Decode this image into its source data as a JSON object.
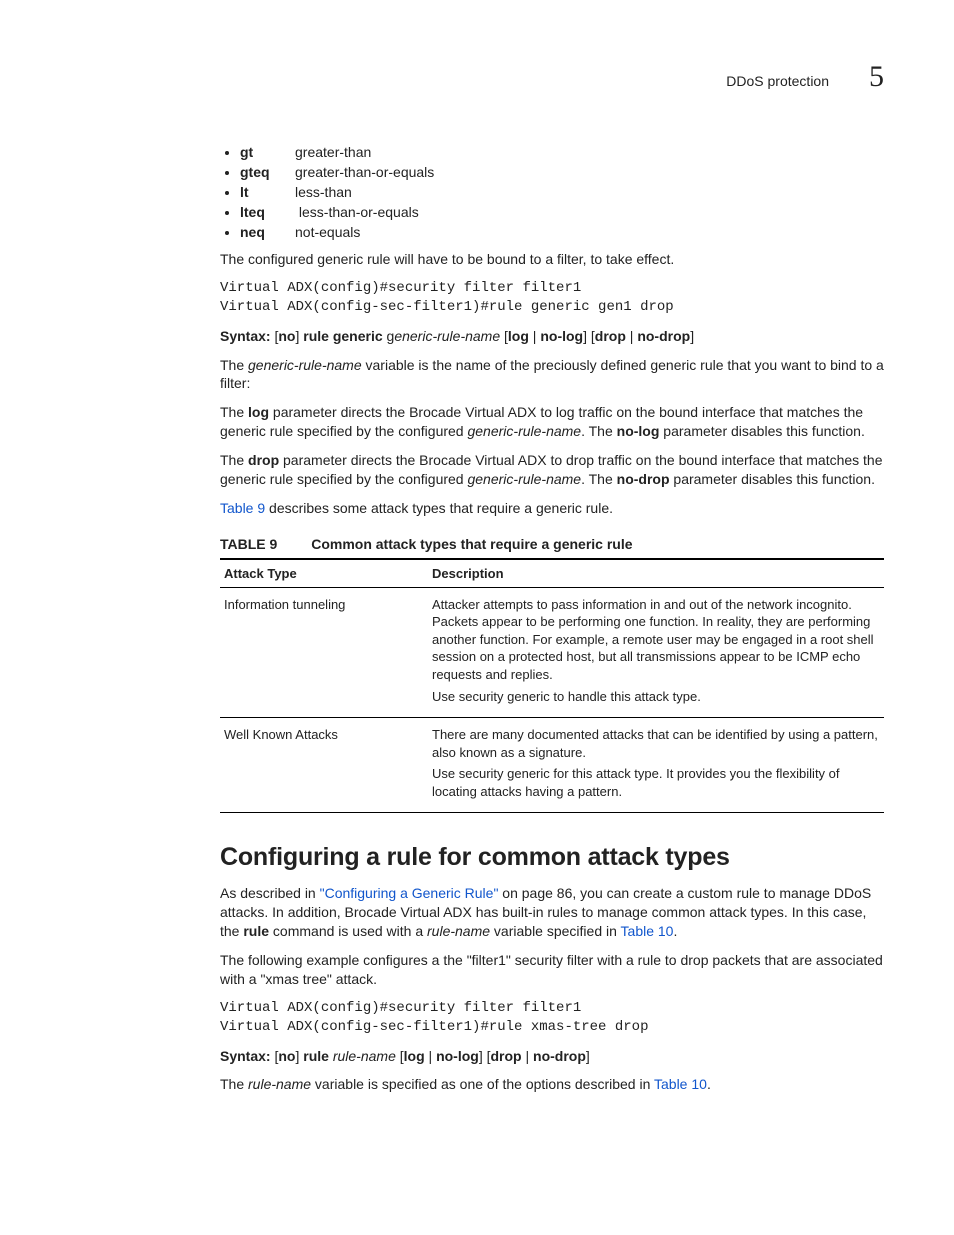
{
  "runhead": {
    "title": "DDoS protection",
    "chapter": "5"
  },
  "oplist": [
    {
      "term": "gt",
      "desc": "greater-than"
    },
    {
      "term": "gteq",
      "desc": "greater-than-or-equals"
    },
    {
      "term": "lt",
      "desc": "less-than"
    },
    {
      "term": "lteq",
      "desc": " less-than-or-equals"
    },
    {
      "term": "neq",
      "desc": "not-equals"
    }
  ],
  "p_bound_intro": "The configured generic rule will have to be bound to a filter, to take effect.",
  "code1": "Virtual ADX(config)#security filter filter1\nVirtual ADX(config-sec-filter1)#rule generic gen1 drop",
  "syntax1": {
    "label": "Syntax:  ",
    "pre_no": "[",
    "no": "no",
    "post_no": "] ",
    "rule_generic": "rule generic",
    "space_g": " g",
    "varname": "eneric-rule-name",
    "space": " ",
    "opt1a": "[",
    "log": "log",
    "pipe1": " | ",
    "nolog": "no-log",
    "opt1b": "] ",
    "opt2a": "[",
    "drop": "drop",
    "pipe2": " | ",
    "nodrop": "no-drop",
    "opt2b": "]"
  },
  "p_varname": {
    "pre": "The ",
    "var": "generic-rule-name",
    "post": " variable is the name of the preciously defined generic rule that you want to bind to a filter:"
  },
  "p_log": {
    "pre": "The ",
    "b1": "log",
    "mid1": " parameter directs the Brocade Virtual ADX to log traffic on the bound interface that matches the generic rule specified by the configured ",
    "var": "generic-rule-name",
    "mid2": ". The ",
    "b2": "no-log",
    "post": " parameter disables this function."
  },
  "p_drop": {
    "pre": "The ",
    "b1": "drop",
    "mid1": " parameter directs the Brocade Virtual ADX to drop traffic on the bound interface that matches the generic rule specified by the configured ",
    "var": "generic-rule-name",
    "mid2": ". The ",
    "b2": "no-drop",
    "post": " parameter disables this function."
  },
  "p_tableref": {
    "link": "Table 9",
    "post": " describes some attack types that require a generic rule."
  },
  "table9": {
    "label": "TABLE 9",
    "title": "Common attack types that require a generic rule",
    "head": {
      "c1": "Attack Type",
      "c2": "Description"
    },
    "rows": [
      {
        "c1": "Information tunneling",
        "c2a": "Attacker attempts to pass information in and out of the network incognito. Packets appear to be performing one function. In reality, they are performing another function. For example, a remote user may be engaged in a root shell session on a protected host, but all transmissions appear to be ICMP echo requests and replies.",
        "c2b": "Use security generic to handle this attack type."
      },
      {
        "c1": "Well Known Attacks",
        "c2a": "There are many documented attacks that can be identified by using a pattern, also known as a signature.",
        "c2b": "Use security generic for this attack type. It provides you the flexibility of locating attacks having a pattern."
      }
    ]
  },
  "h2": "Configuring a rule for common attack types",
  "p_common1": {
    "pre": "As described in ",
    "link1": "\"Configuring a Generic Rule\"",
    "mid1": " on page 86, you can create a custom rule to manage DDoS attacks. In addition, Brocade Virtual ADX has built-in rules to manage common attack types. In this case, the ",
    "b1": "rule",
    "mid2": " command is used with a ",
    "var": "rule-name",
    "mid3": " variable specified in ",
    "link2": "Table 10",
    "post": "."
  },
  "p_common2": "The following example configures a the \"filter1\" security filter with a rule to drop packets that are associated with a \"xmas tree\" attack.",
  "code2": "Virtual ADX(config)#security filter filter1\nVirtual ADX(config-sec-filter1)#rule xmas-tree drop",
  "syntax2": {
    "label": "Syntax:  ",
    "pre_no": "[",
    "no": "no",
    "post_no": "] ",
    "rule": "rule",
    "space": " ",
    "varname": "rule-name",
    "space2": " ",
    "opt1a": "[",
    "log": "log",
    "pipe1": " | ",
    "nolog": "no-log",
    "opt1b": "] ",
    "opt2a": "[",
    "drop": "drop",
    "pipe2": " | ",
    "nodrop": "no-drop",
    "opt2b": "]"
  },
  "p_rulename": {
    "pre": "The ",
    "var": "rule-name",
    "mid": " variable is specified as one of the options described in ",
    "link": "Table 10",
    "post": "."
  }
}
